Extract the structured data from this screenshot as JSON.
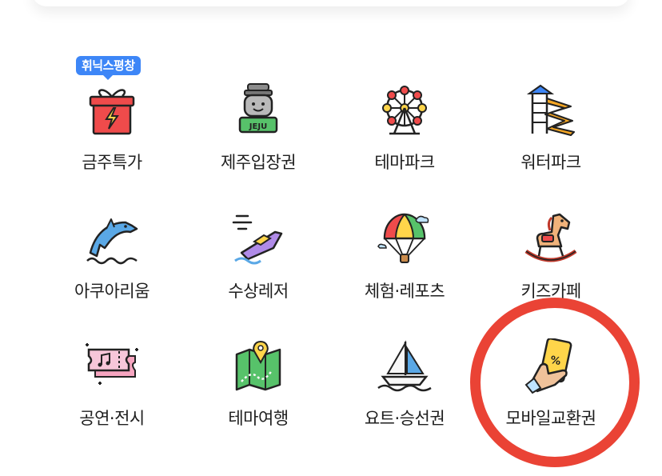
{
  "badge": {
    "text": "휘닉스평창"
  },
  "categories": [
    {
      "label": "금주특가",
      "icon": "gift-lightning-icon"
    },
    {
      "label": "제주입장권",
      "icon": "jeju-character-icon",
      "icon_text": "JEJU"
    },
    {
      "label": "테마파크",
      "icon": "ferris-wheel-icon"
    },
    {
      "label": "워터파크",
      "icon": "water-slide-icon"
    },
    {
      "label": "아쿠아리움",
      "icon": "dolphin-icon"
    },
    {
      "label": "수상레저",
      "icon": "jet-ski-icon"
    },
    {
      "label": "체험·레포츠",
      "icon": "parachute-icon"
    },
    {
      "label": "키즈카페",
      "icon": "rocking-horse-icon"
    },
    {
      "label": "공연·전시",
      "icon": "ticket-music-icon"
    },
    {
      "label": "테마여행",
      "icon": "map-pin-icon"
    },
    {
      "label": "요트·승선권",
      "icon": "sailboat-icon"
    },
    {
      "label": "모바일교환권",
      "icon": "mobile-coupon-icon",
      "icon_text": "%"
    }
  ],
  "colors": {
    "badge": "#3d86f7",
    "highlight_circle": "#ea4335",
    "text": "#1e1e1e"
  }
}
